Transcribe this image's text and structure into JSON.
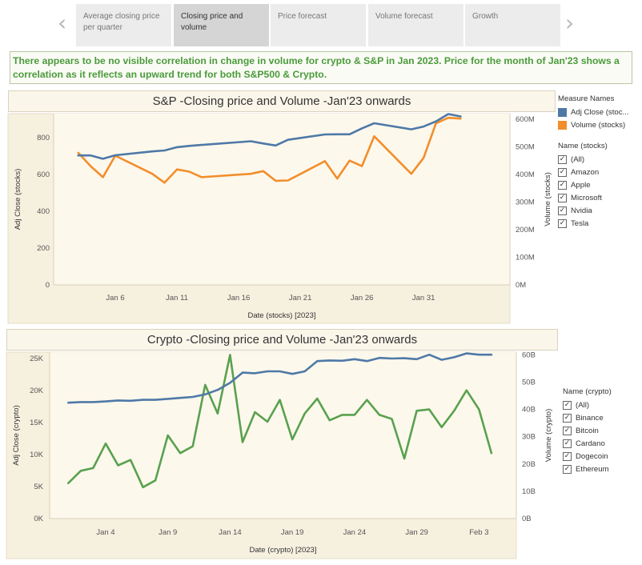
{
  "nav": {
    "prev_icon": "chevron-left-icon",
    "next_icon": "chevron-right-icon",
    "tabs": [
      {
        "label": "Average closing price per quarter",
        "active": false
      },
      {
        "label": "Closing price and volume",
        "active": true
      },
      {
        "label": "Price forecast",
        "active": false
      },
      {
        "label": "Volume forecast",
        "active": false
      },
      {
        "label": "Growth",
        "active": false
      }
    ]
  },
  "insight": "There appears to be no visible correlation in change in volume for crypto & S&P in Jan 2023. Price for the month of Jan'23 shows a correlation as it reflects an upward trend for both S&P500 & Crypto.",
  "colors": {
    "adj_close": "#4e79a7",
    "volume_stocks": "#f28e2b",
    "crypto": "#59a14f",
    "panel_bg": "#fdf8ec",
    "header_bg": "#f6f0df"
  },
  "legend_stocks": {
    "measure_title": "Measure Names",
    "measures": [
      {
        "label": "Adj Close (stoc...",
        "color": "#4e79a7"
      },
      {
        "label": "Volume (stocks)",
        "color": "#f28e2b"
      }
    ],
    "filter_title": "Name (stocks)",
    "filters": [
      "(All)",
      "Amazon",
      "Apple",
      "Microsoft",
      "Nvidia",
      "Tesla"
    ]
  },
  "legend_crypto": {
    "filter_title": "Name (crypto)",
    "filters": [
      "(All)",
      "Binance",
      "Bitcoin",
      "Cardano",
      "Dogecoin",
      "Ethereum"
    ]
  },
  "chart_data": [
    {
      "type": "line",
      "title": "S&P -Closing price and Volume -Jan'23 onwards",
      "xlabel": "Date (stocks) [2023]",
      "ylabel": "Adj Close (stocks)",
      "y2label": "Volume (stocks)",
      "xlim": [
        1,
        38
      ],
      "x_ticks": [
        {
          "x": 6,
          "label": "Jan 6"
        },
        {
          "x": 11,
          "label": "Jan 11"
        },
        {
          "x": 16,
          "label": "Jan 16"
        },
        {
          "x": 21,
          "label": "Jan 21"
        },
        {
          "x": 26,
          "label": "Jan 26"
        },
        {
          "x": 31,
          "label": "Jan 31"
        }
      ],
      "ylim": [
        0,
        930
      ],
      "y_ticks": [
        0,
        200,
        400,
        600,
        800
      ],
      "y_tick_labels": [
        "0",
        "200",
        "400",
        "600",
        "800"
      ],
      "y2lim": [
        0,
        620
      ],
      "y2_ticks": [
        0,
        100,
        200,
        300,
        400,
        500,
        600
      ],
      "y2_tick_labels": [
        "0M",
        "100M",
        "200M",
        "300M",
        "400M",
        "500M",
        "600M"
      ],
      "grid": false,
      "series": [
        {
          "name": "Adj Close (stocks)",
          "axis": "left",
          "color": "#4e79a7",
          "x": [
            3,
            4,
            5,
            6,
            9,
            10,
            11,
            12,
            13,
            17,
            18,
            19,
            20,
            23,
            24,
            25,
            26,
            27,
            30,
            31,
            32,
            33,
            34
          ],
          "y": [
            703,
            703,
            685,
            704,
            725,
            730,
            748,
            755,
            760,
            780,
            768,
            757,
            788,
            817,
            818,
            818,
            850,
            878,
            845,
            860,
            888,
            928,
            915
          ]
        },
        {
          "name": "Volume (stocks)",
          "axis": "right",
          "color": "#f28e2b",
          "x": [
            3,
            4,
            5,
            6,
            9,
            10,
            11,
            12,
            13,
            17,
            18,
            19,
            20,
            23,
            24,
            25,
            26,
            27,
            30,
            31,
            32,
            33,
            34
          ],
          "y": [
            478,
            430,
            390,
            468,
            402,
            370,
            418,
            410,
            390,
            402,
            412,
            377,
            378,
            448,
            385,
            450,
            430,
            538,
            402,
            460,
            585,
            605,
            602
          ]
        }
      ]
    },
    {
      "type": "line",
      "title": "Crypto -Closing price and Volume -Jan'23 onwards",
      "xlabel": "Date (crypto) [2023]",
      "ylabel": "Adj Close (crypto)",
      "y2label": "Volume (crypto)",
      "xlim": [
        -0.5,
        37
      ],
      "x_ticks": [
        {
          "x": 4,
          "label": "Jan 4"
        },
        {
          "x": 9,
          "label": "Jan 9"
        },
        {
          "x": 14,
          "label": "Jan 14"
        },
        {
          "x": 19,
          "label": "Jan 19"
        },
        {
          "x": 24,
          "label": "Jan 24"
        },
        {
          "x": 29,
          "label": "Jan 29"
        },
        {
          "x": 34,
          "label": "Feb 3"
        }
      ],
      "ylim": [
        0,
        26000
      ],
      "y_ticks": [
        0,
        5000,
        10000,
        15000,
        20000,
        25000
      ],
      "y_tick_labels": [
        "0K",
        "5K",
        "10K",
        "15K",
        "20K",
        "25K"
      ],
      "y2lim": [
        0,
        61000
      ],
      "y2_ticks": [
        0,
        10000000000,
        20000000000,
        30000000000,
        40000000000,
        50000000000,
        60000000000
      ],
      "y2_ticks_scaled": [
        0,
        10000,
        20000,
        30000,
        40000,
        50000,
        60000
      ],
      "y2_tick_labels": [
        "0B",
        "10B",
        "20B",
        "30B",
        "40B",
        "50B",
        "60B"
      ],
      "grid": false,
      "series": [
        {
          "name": "Adj Close (crypto)",
          "axis": "left",
          "color": "#4e79a7",
          "x": [
            1,
            2,
            3,
            4,
            5,
            6,
            7,
            8,
            9,
            10,
            11,
            12,
            13,
            14,
            15,
            16,
            17,
            18,
            19,
            20,
            21,
            22,
            23,
            24,
            25,
            26,
            27,
            28,
            29,
            30,
            31,
            32,
            33,
            34,
            35
          ],
          "y": [
            18100,
            18200,
            18200,
            18300,
            18450,
            18400,
            18550,
            18550,
            18700,
            18850,
            19000,
            19400,
            20100,
            21200,
            22800,
            22700,
            23000,
            23000,
            22600,
            23000,
            24600,
            24700,
            24650,
            24900,
            24600,
            25100,
            25000,
            25050,
            24900,
            25600,
            24800,
            25200,
            25800,
            25600,
            25600
          ]
        },
        {
          "name": "Volume (crypto)",
          "axis": "right",
          "color": "#59a14f",
          "x": [
            1,
            2,
            3,
            4,
            5,
            6,
            7,
            8,
            9,
            10,
            11,
            12,
            13,
            14,
            15,
            16,
            17,
            18,
            19,
            20,
            21,
            22,
            23,
            24,
            25,
            26,
            27,
            28,
            29,
            30,
            31,
            32,
            33,
            34,
            35
          ],
          "y": [
            13000,
            17500,
            18500,
            27500,
            19500,
            21500,
            11500,
            14000,
            30500,
            24000,
            26500,
            49000,
            38500,
            60000,
            28000,
            39000,
            35500,
            43500,
            29000,
            38500,
            44000,
            36000,
            38000,
            38000,
            43500,
            38000,
            36500,
            22000,
            39500,
            40000,
            33500,
            39500,
            47000,
            40000,
            24000
          ]
        }
      ]
    }
  ]
}
